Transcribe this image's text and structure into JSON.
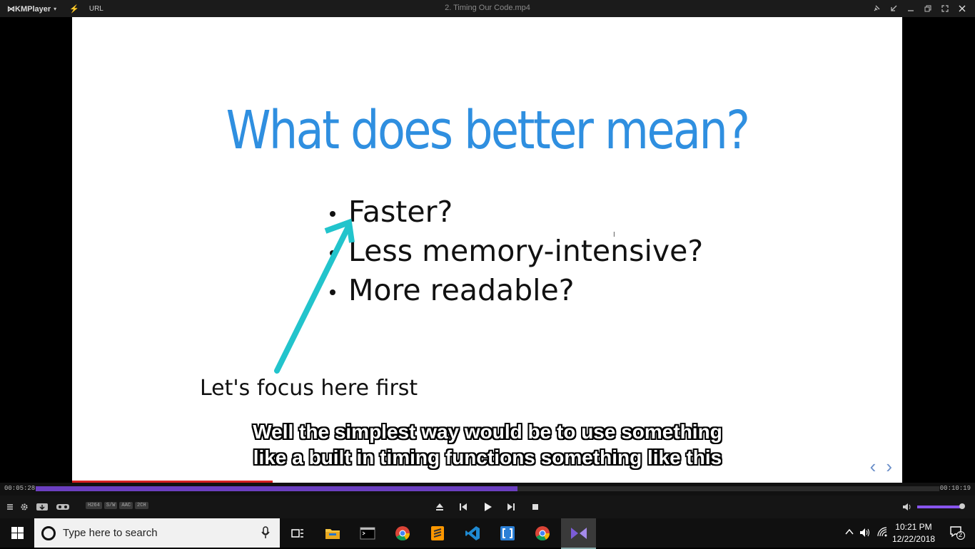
{
  "titlebar": {
    "app_name": "KMPlayer",
    "url_label": "URL",
    "file_title": "2. Timing Our Code.mp4"
  },
  "slide": {
    "title": "What does better mean?",
    "bullets": [
      "Faster?",
      "Less memory-intensive?",
      "More readable?"
    ],
    "annotation": "Let's focus here first"
  },
  "subtitle": {
    "line1": "Well the simplest way would be to use something",
    "line2": "like a built in timing functions something like this"
  },
  "playback": {
    "current_time": "00:05:28",
    "total_time": "00:10:19",
    "progress_fraction": 0.533,
    "volume_fraction": 0.95,
    "badges": [
      "H264",
      "S/W",
      "AAC",
      "2CH"
    ]
  },
  "taskbar": {
    "search_placeholder": "Type here to search",
    "time": "10:21 PM",
    "date": "12/22/2018",
    "notification_count": "2"
  },
  "colors": {
    "slide_title": "#2f8fe0",
    "arrow": "#22c4cc",
    "seek_fill": "#6b3fc0",
    "volume_fill": "#8855ee"
  }
}
